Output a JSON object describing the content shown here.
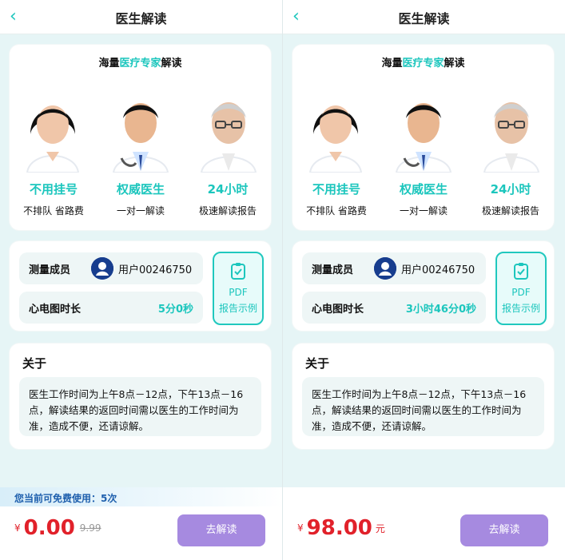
{
  "colors": {
    "accent": "#1cc6bd",
    "price": "#e1212a",
    "button": "#a68ae0",
    "banner_text": "#1e5fad"
  },
  "header": {
    "back_icon": "chevron-left-icon",
    "title": "医生解读"
  },
  "intro": {
    "heading_pre": "海量",
    "heading_accent": "医疗专家",
    "heading_post": "解读",
    "doctors": [
      {
        "kind": "female-doctor-portrait"
      },
      {
        "kind": "male-doctor-portrait"
      },
      {
        "kind": "senior-doctor-portrait"
      }
    ],
    "features": [
      {
        "title": "不用挂号",
        "subtitle": "不排队 省路费"
      },
      {
        "title": "权威医生",
        "subtitle": "一对一解读"
      },
      {
        "title": "24小时",
        "subtitle": "极速解读报告"
      }
    ]
  },
  "info": {
    "member_label": "测量成员",
    "avatar_icon": "user-avatar-icon",
    "username": "用户00246750",
    "ecg_label": "心电图时长",
    "pdf_icon": "clipboard-check-icon",
    "pdf_line1": "PDF",
    "pdf_line2": "报告示例"
  },
  "about": {
    "title": "关于",
    "text": "医生工作时间为上午8点－12点，下午13点－16点，解读结果的返回时间需以医生的工作时间为准，造成不便，还请谅解。"
  },
  "panes": [
    {
      "ecg_duration": "5分0秒",
      "free_banner": "您当前可免费使用：5次",
      "currency": "¥",
      "price": "0.00",
      "original_price": "9.99",
      "unit": "",
      "button_label": "去解读"
    },
    {
      "ecg_duration": "3小时46分0秒",
      "free_banner": "",
      "currency": "¥",
      "price": "98.00",
      "original_price": "",
      "unit": "元",
      "button_label": "去解读"
    }
  ]
}
